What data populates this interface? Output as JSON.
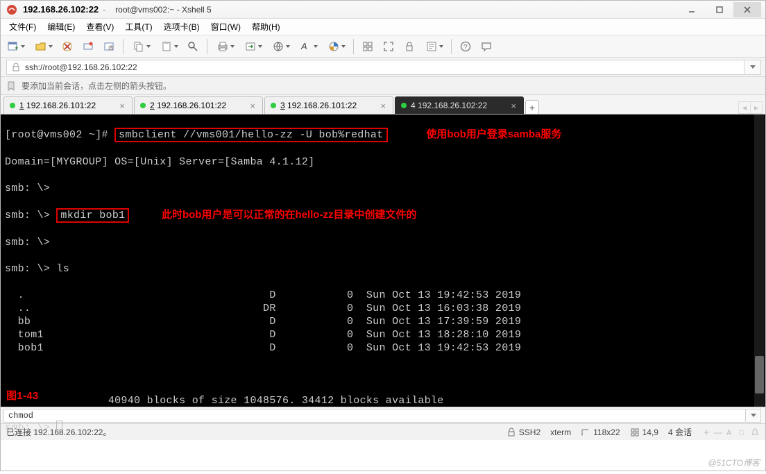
{
  "titlebar": {
    "ip_title": "192.168.26.102:22",
    "session_title": "root@vms002:~ - Xshell 5"
  },
  "menu": [
    {
      "label": "文件(F)"
    },
    {
      "label": "编辑(E)"
    },
    {
      "label": "查看(V)"
    },
    {
      "label": "工具(T)"
    },
    {
      "label": "选项卡(B)"
    },
    {
      "label": "窗口(W)"
    },
    {
      "label": "帮助(H)"
    }
  ],
  "address": {
    "url": "ssh://root@192.168.26.102:22"
  },
  "hint": {
    "text": "要添加当前会话，点击左侧的箭头按钮。"
  },
  "tabs": [
    {
      "num": "1",
      "label": "192.168.26.101:22",
      "active": false
    },
    {
      "num": "2",
      "label": "192.168.26.101:22",
      "active": false
    },
    {
      "num": "3",
      "label": "192.168.26.101:22",
      "active": false
    },
    {
      "num": "4",
      "label": "192.168.26.102:22",
      "active": true
    }
  ],
  "terminal": {
    "prompt": "[root@vms002 ~]# ",
    "cmd1": "smbclient //vms001/hello-zz -U bob%redhat",
    "ann1": "使用bob用户登录samba服务",
    "line_domain": "Domain=[MYGROUP] OS=[Unix] Server=[Samba 4.1.12]",
    "smb_prompt": "smb: \\> ",
    "cmd_mkdir": "mkdir bob1",
    "ann2": "此时bob用户是可以正常的在hello-zz目录中创建文件的",
    "cmd_ls": "ls",
    "listing": [
      {
        "name": ".",
        "type": "D",
        "size": "0",
        "date": "Sun Oct 13 19:42:53 2019"
      },
      {
        "name": "..",
        "type": "DR",
        "size": "0",
        "date": "Sun Oct 13 16:03:38 2019"
      },
      {
        "name": "bb",
        "type": "D",
        "size": "0",
        "date": "Sun Oct 13 17:39:59 2019"
      },
      {
        "name": "tom1",
        "type": "D",
        "size": "0",
        "date": "Sun Oct 13 18:28:10 2019"
      },
      {
        "name": "bob1",
        "type": "D",
        "size": "0",
        "date": "Sun Oct 13 19:42:53 2019"
      }
    ],
    "blocks_line": "                40940 blocks of size 1048576. 34412 blocks available",
    "fig": "图1-43"
  },
  "cmdbox": {
    "value": "chmod"
  },
  "status": {
    "connected": "已连接 192.168.26.102:22。",
    "proto": "SSH2",
    "term": "xterm",
    "size": "118x22",
    "pos": "14,9",
    "sessions": "4 会话"
  },
  "watermark": "@51CTO博客"
}
